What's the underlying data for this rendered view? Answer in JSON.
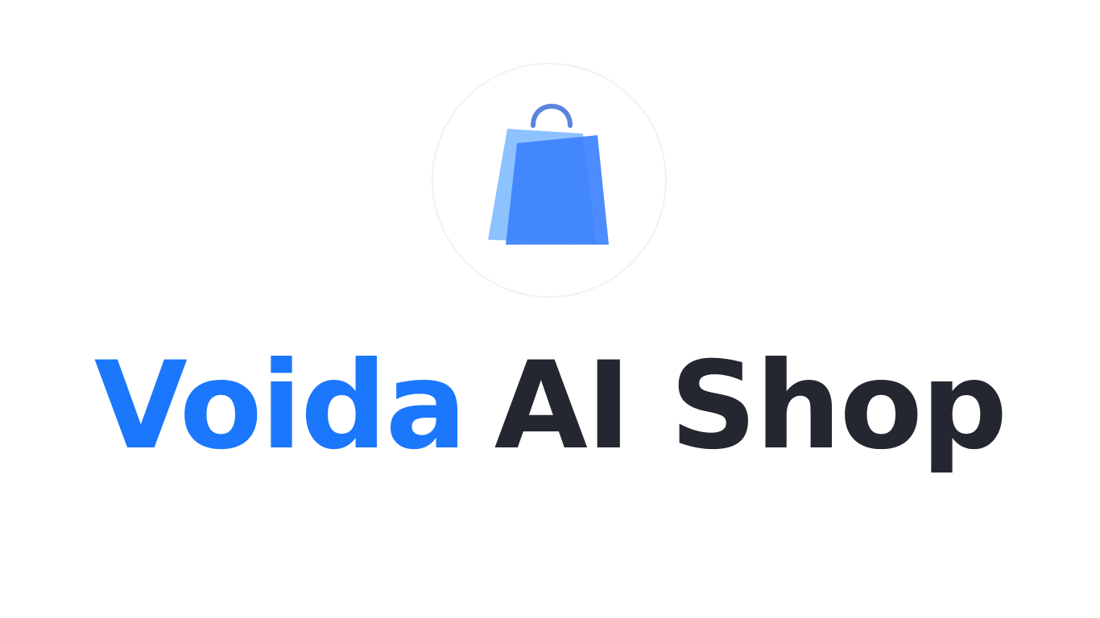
{
  "splash": {
    "logo_icon": "shopping-bag-icon",
    "title_brand": "Voida",
    "title_rest": "AI Shop",
    "colors": {
      "brand_blue": "#1b77fc",
      "title_dark": "#252730",
      "bag_front": "#3d82fe",
      "bag_back": "#8cc2fd",
      "bag_handle": "#5b84df",
      "circle_border": "#f2f2f4",
      "background": "#ffffff"
    }
  }
}
